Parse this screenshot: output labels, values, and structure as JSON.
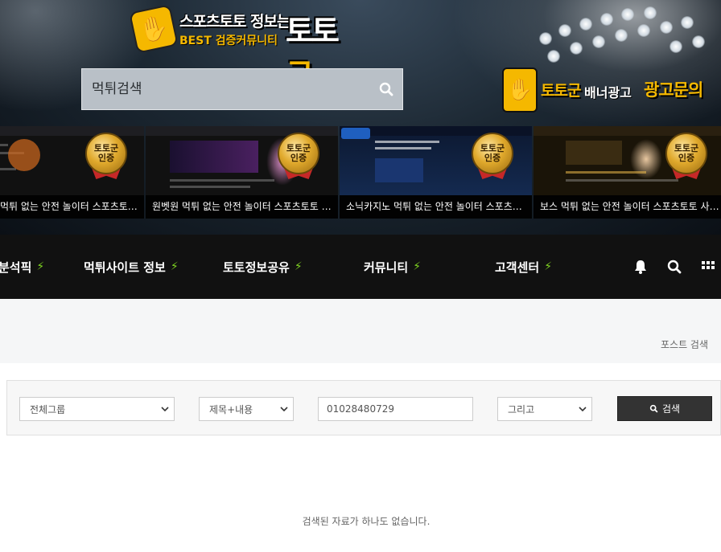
{
  "logo": {
    "main": "스포츠토토 정보는",
    "sub": "BEST 검증커뮤니티",
    "big_a": "토토",
    "big_b": "군"
  },
  "search": {
    "placeholder": "먹튀검색",
    "icon": "search-icon"
  },
  "ad": {
    "brand": "토토군",
    "middle": "배너광고",
    "cta": "광고문의"
  },
  "banners": [
    {
      "caption": "먹튀 없는 안전 놀이터 스포츠토토 사이트 인증",
      "medal_top": "토토군",
      "medal_bottom": "인증",
      "tint": "#3a1f12"
    },
    {
      "caption": "원벳원 먹튀 없는 안전 놀이터 스포츠토토 사이트",
      "medal_top": "토토군",
      "medal_bottom": "인증",
      "tint": "#2a1733"
    },
    {
      "caption": "소닉카지노 먹튀 없는 안전 놀이터 스포츠토토",
      "medal_top": "토토군",
      "medal_bottom": "인증",
      "tint": "#101f3d"
    },
    {
      "caption": "보스 먹튀 없는 안전 놀이터 스포츠토토 사이트",
      "medal_top": "토토군",
      "medal_bottom": "인증",
      "tint": "#2b2410"
    }
  ],
  "nav": {
    "items": [
      "분석픽",
      "먹튀사이트 정보",
      "토토정보공유",
      "커뮤니티",
      "고객센터"
    ],
    "icons": [
      "bell-icon",
      "search-icon",
      "grid-icon"
    ]
  },
  "page": {
    "title": "포스트 검색",
    "empty_message": "검색된 자료가 하나도 없습니다."
  },
  "form": {
    "group_select": "전체그룹",
    "field_select": "제목+내용",
    "keyword": "01028480729",
    "operator_select": "그리고",
    "submit_label": "검색"
  },
  "colors": {
    "accent_yellow": "#f5b800",
    "bolt_green": "#7ed321",
    "nav_bg": "#111111",
    "button_bg": "#333333"
  }
}
